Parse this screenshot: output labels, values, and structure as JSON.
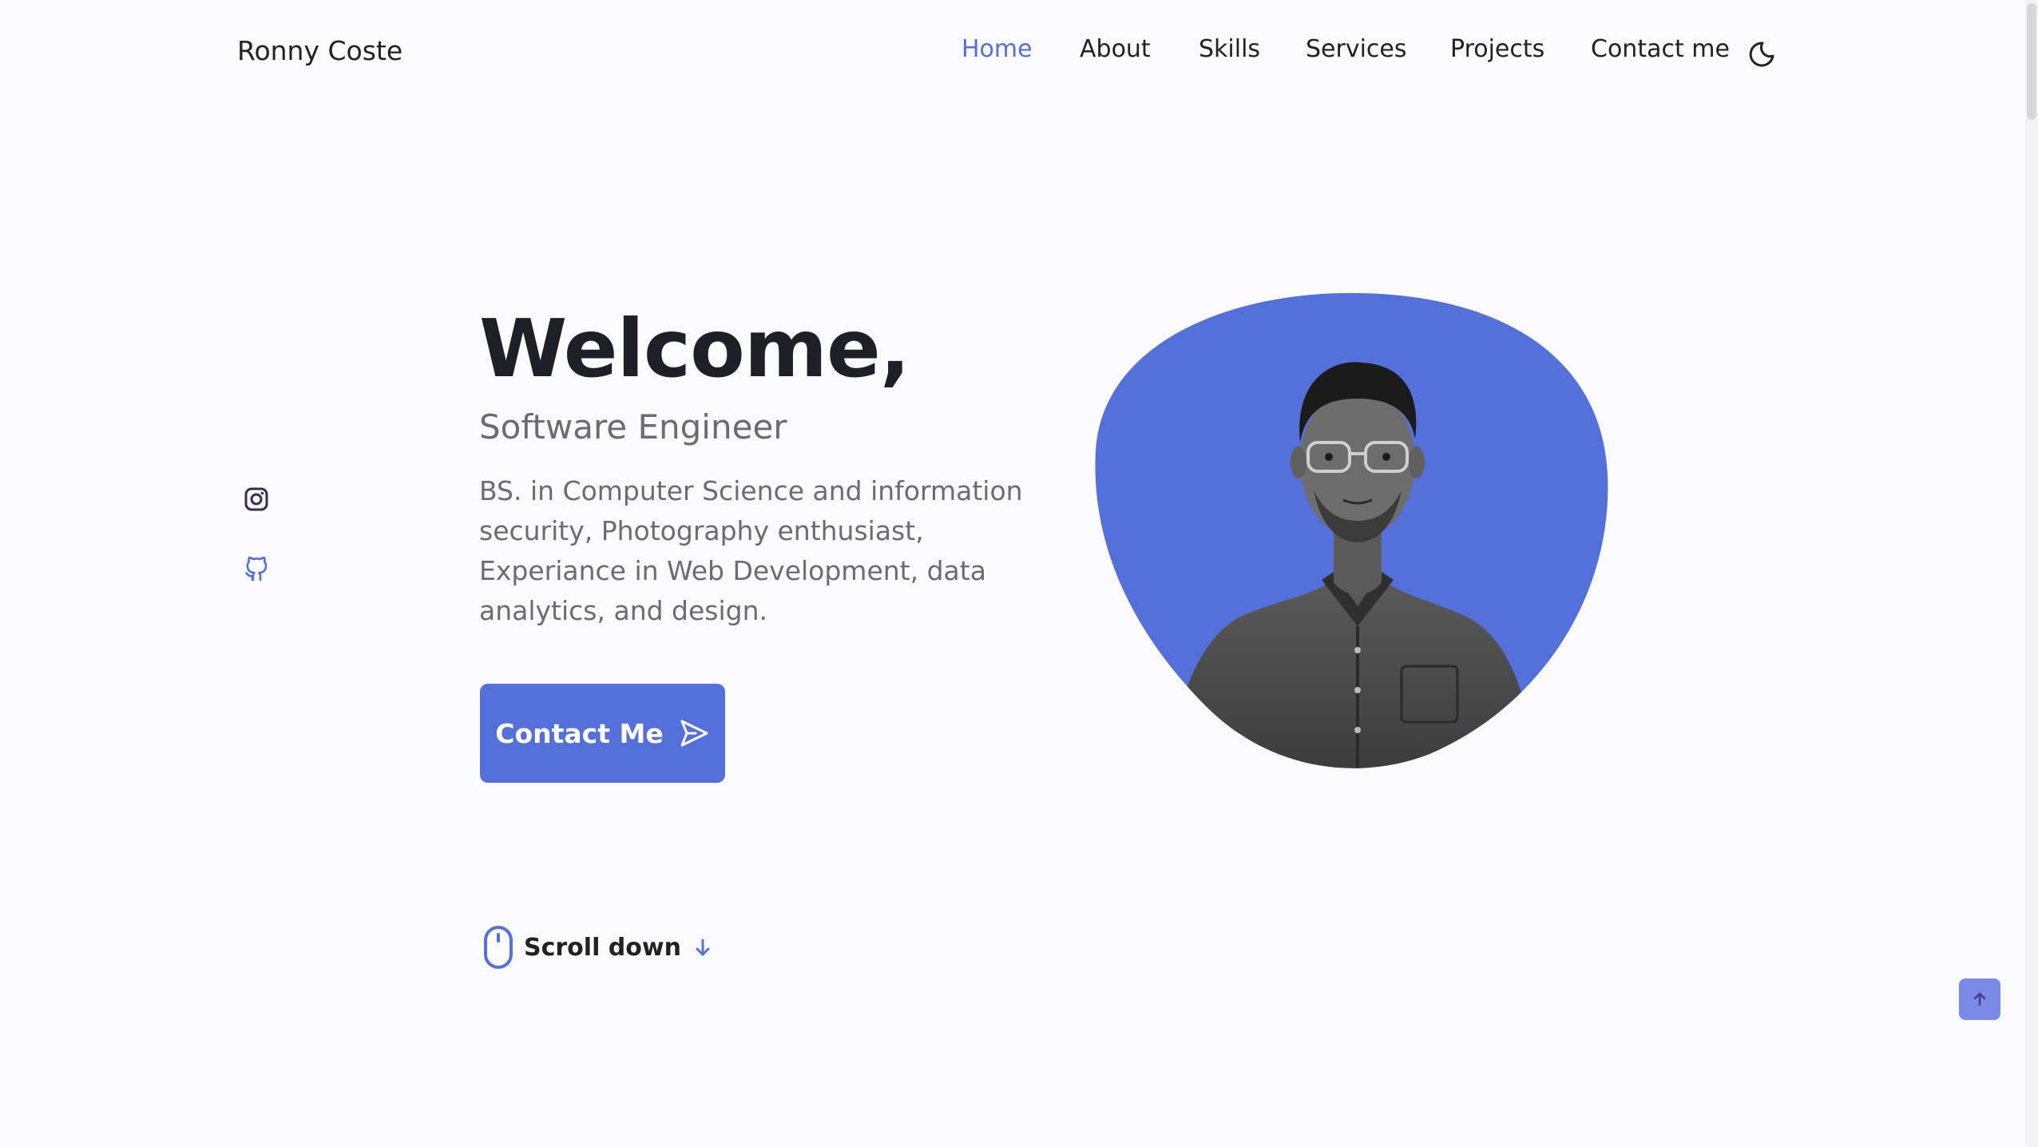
{
  "brand": "Ronny Coste",
  "nav": {
    "items": [
      {
        "label": "Home",
        "active": true
      },
      {
        "label": "About",
        "active": false
      },
      {
        "label": "Skills",
        "active": false
      },
      {
        "label": "Services",
        "active": false
      },
      {
        "label": "Projects",
        "active": false
      },
      {
        "label": "Contact me",
        "active": false
      }
    ],
    "theme_icon": "moon-icon"
  },
  "social": [
    {
      "icon": "instagram-icon"
    },
    {
      "icon": "github-icon"
    }
  ],
  "hero": {
    "title": "Welcome,",
    "subtitle": "Software Engineer",
    "description": "BS. in Computer Science and information security, Photography enthusiast, Experiance in Web Development, data analytics, and design.",
    "cta_label": "Contact Me",
    "cta_icon": "send-icon",
    "image_icon": "profile-photo"
  },
  "scroll_down": {
    "label": "Scroll down",
    "icons": [
      "mouse-icon",
      "arrow-down-icon"
    ]
  },
  "scroll_up_icon": "arrow-up-icon",
  "colors": {
    "accent": "#5670d9",
    "background": "#fbfbfe",
    "title": "#1f1f28",
    "text_muted": "#6b6b78",
    "scroll_up_bg": "#7b8ae6"
  }
}
